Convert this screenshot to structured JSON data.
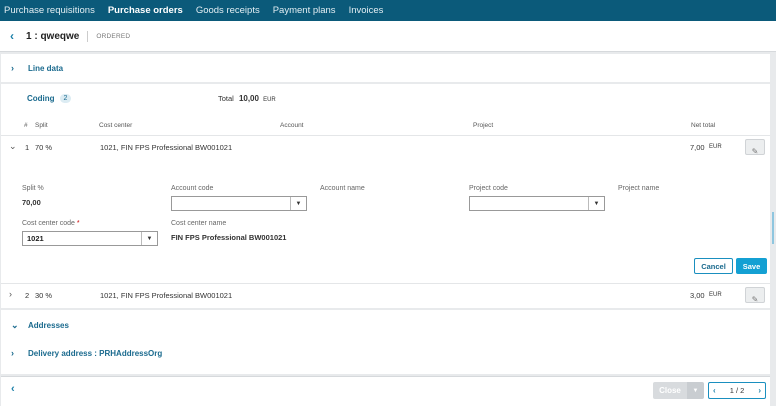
{
  "nav": {
    "tabs": [
      {
        "label": "Purchase requisitions"
      },
      {
        "label": "Purchase orders"
      },
      {
        "label": "Goods receipts"
      },
      {
        "label": "Payment plans"
      },
      {
        "label": "Invoices"
      }
    ]
  },
  "header": {
    "title": "1 : qweqwe",
    "status": "ORDERED"
  },
  "line_data": {
    "label": "Line data"
  },
  "coding": {
    "label": "Coding",
    "count": "2",
    "total_label": "Total",
    "total_value": "10,00",
    "total_currency": "EUR",
    "columns": {
      "num": "#",
      "split": "Split",
      "cost_center": "Cost center",
      "account": "Account",
      "project": "Project",
      "net_total": "Net total"
    },
    "rows": [
      {
        "num": "1",
        "split": "70 %",
        "cost_center": "1021, FIN FPS Professional BW001021",
        "net_total": "7,00",
        "currency": "EUR"
      },
      {
        "num": "2",
        "split": "30 %",
        "cost_center": "1021, FIN FPS Professional BW001021",
        "net_total": "3,00",
        "currency": "EUR"
      }
    ],
    "form": {
      "split_label": "Split %",
      "split_value": "70,00",
      "account_code_label": "Account code",
      "account_code_value": "",
      "account_name_label": "Account name",
      "project_code_label": "Project code",
      "project_code_value": "",
      "project_name_label": "Project name",
      "cost_center_code_label": "Cost center code",
      "required_mark": "*",
      "cost_center_code_value": "1021",
      "cost_center_name_label": "Cost center name",
      "cost_center_name_value": "FIN FPS Professional BW001021",
      "cancel_label": "Cancel",
      "save_label": "Save"
    }
  },
  "addresses": {
    "label": "Addresses",
    "delivery_label": "Delivery address : PRHAddressOrg"
  },
  "footer": {
    "close_label": "Close",
    "page_indicator": "1 / 2"
  },
  "icons": {
    "back": "chevron-left-icon",
    "expand": "chevron-right-icon",
    "collapse": "chevron-down-icon",
    "edit": "pencil-icon"
  },
  "colors": {
    "nav_bg": "#0b5a7a",
    "accent": "#1a6a8e",
    "save_bg": "#14a0d3"
  }
}
